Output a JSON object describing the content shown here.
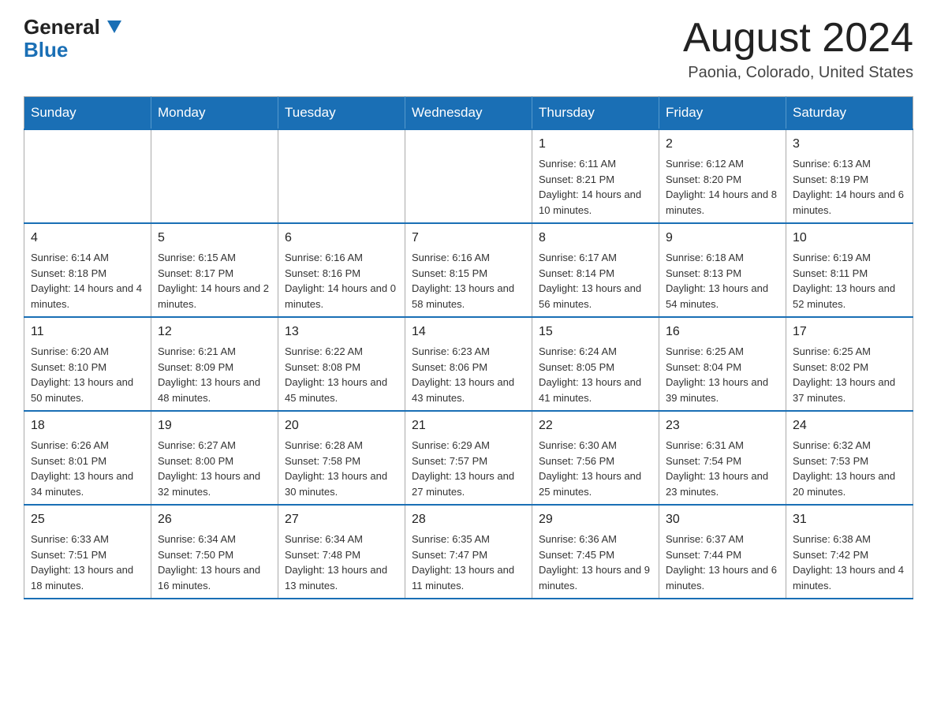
{
  "header": {
    "logo_general": "General",
    "logo_blue": "Blue",
    "month_title": "August 2024",
    "location": "Paonia, Colorado, United States"
  },
  "calendar": {
    "days_of_week": [
      "Sunday",
      "Monday",
      "Tuesday",
      "Wednesday",
      "Thursday",
      "Friday",
      "Saturday"
    ],
    "weeks": [
      [
        {
          "day": "",
          "info": ""
        },
        {
          "day": "",
          "info": ""
        },
        {
          "day": "",
          "info": ""
        },
        {
          "day": "",
          "info": ""
        },
        {
          "day": "1",
          "info": "Sunrise: 6:11 AM\nSunset: 8:21 PM\nDaylight: 14 hours and 10 minutes."
        },
        {
          "day": "2",
          "info": "Sunrise: 6:12 AM\nSunset: 8:20 PM\nDaylight: 14 hours and 8 minutes."
        },
        {
          "day": "3",
          "info": "Sunrise: 6:13 AM\nSunset: 8:19 PM\nDaylight: 14 hours and 6 minutes."
        }
      ],
      [
        {
          "day": "4",
          "info": "Sunrise: 6:14 AM\nSunset: 8:18 PM\nDaylight: 14 hours and 4 minutes."
        },
        {
          "day": "5",
          "info": "Sunrise: 6:15 AM\nSunset: 8:17 PM\nDaylight: 14 hours and 2 minutes."
        },
        {
          "day": "6",
          "info": "Sunrise: 6:16 AM\nSunset: 8:16 PM\nDaylight: 14 hours and 0 minutes."
        },
        {
          "day": "7",
          "info": "Sunrise: 6:16 AM\nSunset: 8:15 PM\nDaylight: 13 hours and 58 minutes."
        },
        {
          "day": "8",
          "info": "Sunrise: 6:17 AM\nSunset: 8:14 PM\nDaylight: 13 hours and 56 minutes."
        },
        {
          "day": "9",
          "info": "Sunrise: 6:18 AM\nSunset: 8:13 PM\nDaylight: 13 hours and 54 minutes."
        },
        {
          "day": "10",
          "info": "Sunrise: 6:19 AM\nSunset: 8:11 PM\nDaylight: 13 hours and 52 minutes."
        }
      ],
      [
        {
          "day": "11",
          "info": "Sunrise: 6:20 AM\nSunset: 8:10 PM\nDaylight: 13 hours and 50 minutes."
        },
        {
          "day": "12",
          "info": "Sunrise: 6:21 AM\nSunset: 8:09 PM\nDaylight: 13 hours and 48 minutes."
        },
        {
          "day": "13",
          "info": "Sunrise: 6:22 AM\nSunset: 8:08 PM\nDaylight: 13 hours and 45 minutes."
        },
        {
          "day": "14",
          "info": "Sunrise: 6:23 AM\nSunset: 8:06 PM\nDaylight: 13 hours and 43 minutes."
        },
        {
          "day": "15",
          "info": "Sunrise: 6:24 AM\nSunset: 8:05 PM\nDaylight: 13 hours and 41 minutes."
        },
        {
          "day": "16",
          "info": "Sunrise: 6:25 AM\nSunset: 8:04 PM\nDaylight: 13 hours and 39 minutes."
        },
        {
          "day": "17",
          "info": "Sunrise: 6:25 AM\nSunset: 8:02 PM\nDaylight: 13 hours and 37 minutes."
        }
      ],
      [
        {
          "day": "18",
          "info": "Sunrise: 6:26 AM\nSunset: 8:01 PM\nDaylight: 13 hours and 34 minutes."
        },
        {
          "day": "19",
          "info": "Sunrise: 6:27 AM\nSunset: 8:00 PM\nDaylight: 13 hours and 32 minutes."
        },
        {
          "day": "20",
          "info": "Sunrise: 6:28 AM\nSunset: 7:58 PM\nDaylight: 13 hours and 30 minutes."
        },
        {
          "day": "21",
          "info": "Sunrise: 6:29 AM\nSunset: 7:57 PM\nDaylight: 13 hours and 27 minutes."
        },
        {
          "day": "22",
          "info": "Sunrise: 6:30 AM\nSunset: 7:56 PM\nDaylight: 13 hours and 25 minutes."
        },
        {
          "day": "23",
          "info": "Sunrise: 6:31 AM\nSunset: 7:54 PM\nDaylight: 13 hours and 23 minutes."
        },
        {
          "day": "24",
          "info": "Sunrise: 6:32 AM\nSunset: 7:53 PM\nDaylight: 13 hours and 20 minutes."
        }
      ],
      [
        {
          "day": "25",
          "info": "Sunrise: 6:33 AM\nSunset: 7:51 PM\nDaylight: 13 hours and 18 minutes."
        },
        {
          "day": "26",
          "info": "Sunrise: 6:34 AM\nSunset: 7:50 PM\nDaylight: 13 hours and 16 minutes."
        },
        {
          "day": "27",
          "info": "Sunrise: 6:34 AM\nSunset: 7:48 PM\nDaylight: 13 hours and 13 minutes."
        },
        {
          "day": "28",
          "info": "Sunrise: 6:35 AM\nSunset: 7:47 PM\nDaylight: 13 hours and 11 minutes."
        },
        {
          "day": "29",
          "info": "Sunrise: 6:36 AM\nSunset: 7:45 PM\nDaylight: 13 hours and 9 minutes."
        },
        {
          "day": "30",
          "info": "Sunrise: 6:37 AM\nSunset: 7:44 PM\nDaylight: 13 hours and 6 minutes."
        },
        {
          "day": "31",
          "info": "Sunrise: 6:38 AM\nSunset: 7:42 PM\nDaylight: 13 hours and 4 minutes."
        }
      ]
    ]
  }
}
